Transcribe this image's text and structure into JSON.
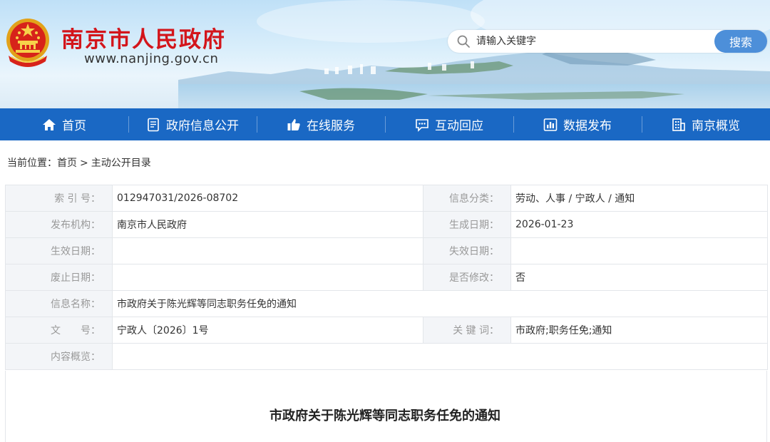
{
  "header": {
    "site_title": "南京市人民政府",
    "site_url": "www.nanjing.gov.cn",
    "search_placeholder": "请输入关键字",
    "search_button": "搜索"
  },
  "nav": [
    {
      "label": "首页",
      "icon": "home-icon"
    },
    {
      "label": "政府信息公开",
      "icon": "document-icon"
    },
    {
      "label": "在线服务",
      "icon": "thumbs-up-icon"
    },
    {
      "label": "互动回应",
      "icon": "chat-icon"
    },
    {
      "label": "数据发布",
      "icon": "chart-icon"
    },
    {
      "label": "南京概览",
      "icon": "building-icon"
    }
  ],
  "breadcrumb": {
    "prefix": "当前位置：",
    "home": "首页",
    "separator": ">",
    "current": "主动公开目录"
  },
  "info": {
    "index_no_label": "索 引 号：",
    "index_no": "012947031/2026-08702",
    "category_label": "信息分类：",
    "category": "劳动、人事 / 宁政人 / 通知",
    "publisher_label": "发布机构：",
    "publisher": "南京市人民政府",
    "created_label": "生成日期：",
    "created": "2026-01-23",
    "effective_label": "生效日期：",
    "effective": "",
    "expiry_label": "失效日期：",
    "expiry": "",
    "abolished_label": "废止日期：",
    "abolished": "",
    "modified_label": "是否修改：",
    "modified": "否",
    "name_label": "信息名称：",
    "name": "市政府关于陈光辉等同志职务任免的通知",
    "doc_no_label": "文　　号：",
    "doc_no": "宁政人〔2026〕1号",
    "keywords_label": "关 键 词：",
    "keywords": "市政府;职务任免;通知",
    "summary_label": "内容概览：",
    "summary": ""
  },
  "article": {
    "title": "市政府关于陈光辉等同志职务任免的通知"
  },
  "colors": {
    "nav_bg": "#1a68c4",
    "title_red": "#d3151b",
    "search_button": "#4d8fd9"
  }
}
